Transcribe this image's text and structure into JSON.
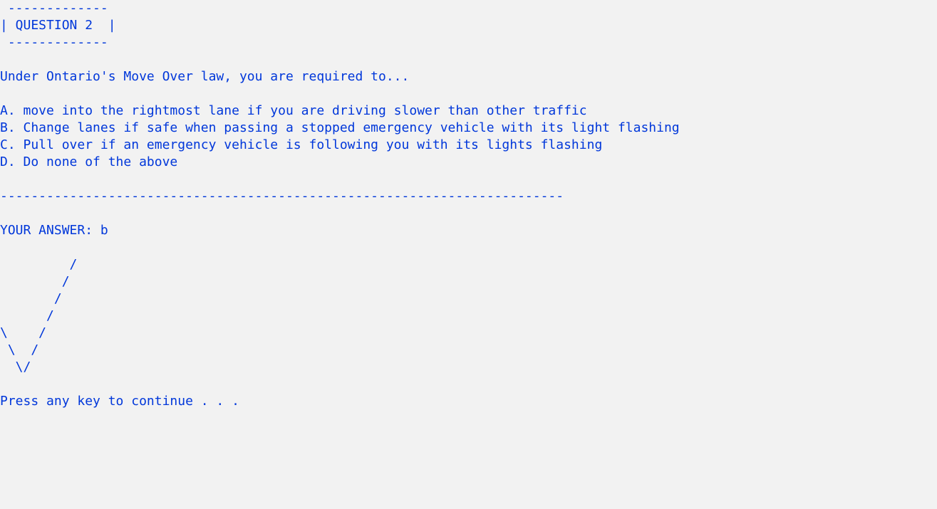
{
  "header": {
    "box_top": " -------------",
    "title_line": "| QUESTION 2  |",
    "box_bottom": " -------------"
  },
  "question": {
    "prompt": "Under Ontario's Move Over law, you are required to...",
    "options": [
      "A. move into the rightmost lane if you are driving slower than other traffic",
      "B. Change lanes if safe when passing a stopped emergency vehicle with its light flashing",
      "C. Pull over if an emergency vehicle is following you with its lights flashing",
      "D. Do none of the above"
    ]
  },
  "divider": "-------------------------------------------------------------------------",
  "answer": {
    "text": "YOUR ANSWER: b"
  },
  "checkmark": {
    "lines": [
      "         /",
      "        /",
      "       /",
      "      /",
      "\\    /",
      " \\  /",
      "  \\/"
    ]
  },
  "footer": {
    "prompt": "Press any key to continue . . ."
  },
  "colors": {
    "background": "#f2f2f2",
    "text": "#0037da"
  }
}
